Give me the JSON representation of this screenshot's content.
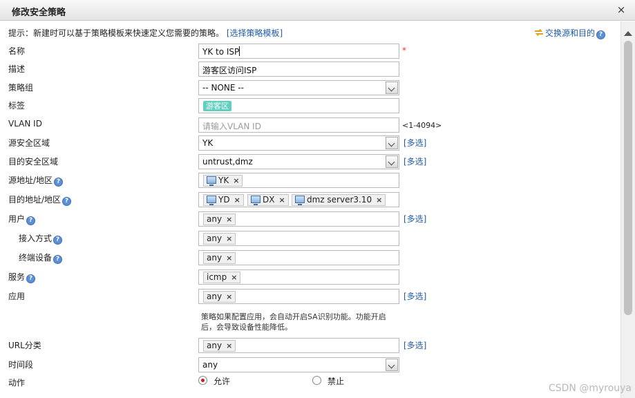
{
  "dialog": {
    "title": "修改安全策略",
    "close_glyph": "×"
  },
  "hint": {
    "text": "提示：新建时可以基于策略模板来快速定义您需要的策略。",
    "link": "[选择策略模板]"
  },
  "swap": {
    "label": "交换源和目的"
  },
  "help_glyph": "?",
  "chip_remove": "×",
  "multi_select": "[多选]",
  "form": {
    "name": {
      "label": "名称",
      "value": "YK to ISP",
      "required_mark": "*"
    },
    "description": {
      "label": "描述",
      "value": "游客区访问ISP"
    },
    "policy_group": {
      "label": "策略组",
      "value": "-- NONE --"
    },
    "tags": {
      "label": "标签",
      "chip": "游客区"
    },
    "vlan_id": {
      "label": "VLAN ID",
      "placeholder": "请输入VLAN ID",
      "range": "<1-4094>"
    },
    "src_zone": {
      "label": "源安全区域",
      "value": "YK"
    },
    "dst_zone": {
      "label": "目的安全区域",
      "value": "untrust,dmz"
    },
    "src_addr": {
      "label": "源地址/地区",
      "chips": [
        "YK"
      ]
    },
    "dst_addr": {
      "label": "目的地址/地区",
      "chips": [
        "YD",
        "DX",
        "dmz server3.10"
      ]
    },
    "user": {
      "label": "用户",
      "chip": "any"
    },
    "access_method": {
      "label": "接入方式",
      "chip": "any"
    },
    "terminal": {
      "label": "终端设备",
      "chip": "any"
    },
    "service": {
      "label": "服务",
      "chip": "icmp"
    },
    "application": {
      "label": "应用",
      "chip": "any",
      "note_line1": "策略如果配置应用，会自动开启SA识别功能。功能开启",
      "note_line2": "后，会导致设备性能降低。"
    },
    "url_category": {
      "label": "URL分类",
      "chip": "any"
    },
    "time_range": {
      "label": "时间段",
      "value": "any"
    },
    "action": {
      "label": "动作",
      "options": [
        "允许",
        "禁止"
      ],
      "selected": "允许"
    }
  },
  "watermark": "CSDN @myrouya",
  "colors": {
    "link": "#1f5aa6",
    "tag": "#5fd0c0",
    "radio_selected": "#d01818",
    "required": "#e03030"
  }
}
